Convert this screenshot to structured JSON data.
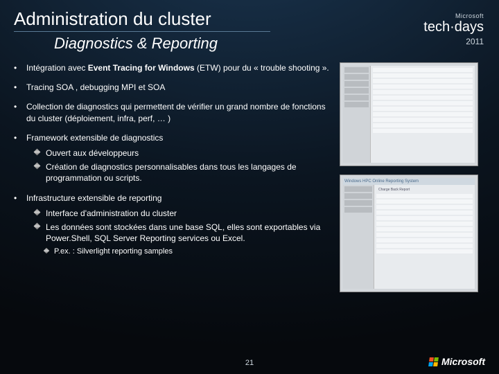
{
  "header": {
    "title": "Administration du cluster",
    "subtitle": "Diagnostics & Reporting"
  },
  "brand": {
    "company": "Microsoft",
    "product": "tech·days",
    "year": "2011"
  },
  "bullets": [
    {
      "text_pre": "Intégration avec ",
      "text_bold": "Event Tracing for Windows",
      "text_post": " (ETW) pour du « trouble shooting »."
    },
    {
      "text": "Tracing SOA , debugging MPI et SOA"
    },
    {
      "text": "Collection de diagnostics qui permettent de vérifier un grand nombre de fonctions du cluster (déploiement, infra, perf, … )"
    },
    {
      "text": "Framework extensible de diagnostics",
      "subs": [
        "Ouvert aux développeurs",
        "Création de diagnostics personnalisables dans tous les langages de programmation ou scripts."
      ]
    },
    {
      "text": "Infrastructure extensible de reporting",
      "subs": [
        "Interface d'administration du cluster",
        "Les données sont stockées dans une base SQL, elles sont exportables via Power.Shell, SQL Server Reporting services ou Excel."
      ],
      "subsubs": [
        "P.ex. : Silverlight reporting samples"
      ]
    }
  ],
  "screenshots": {
    "top_caption": "",
    "bottom_title": "Windows HPC Online Reporting System",
    "bottom_subtitle": "Charge Back Report"
  },
  "footer": {
    "logo_text": "Microsoft",
    "page_number": "21"
  }
}
